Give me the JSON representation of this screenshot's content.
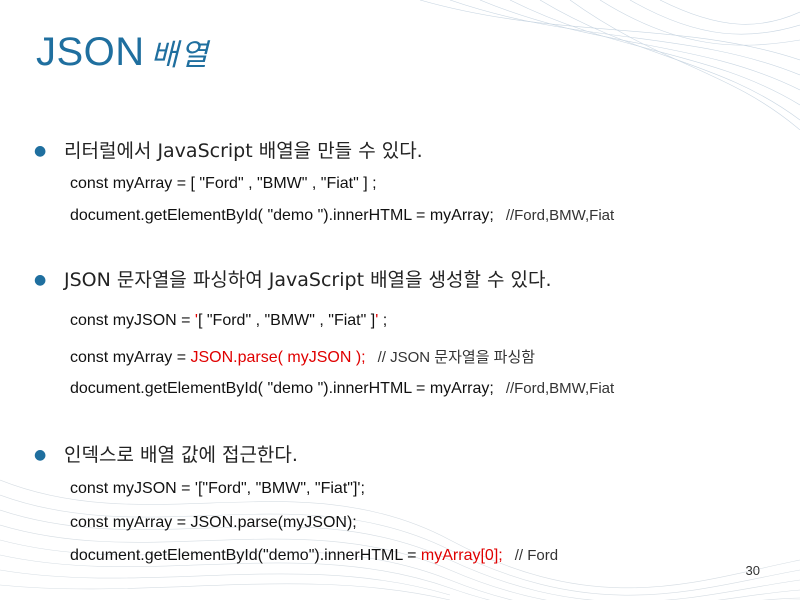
{
  "slide": {
    "title": "JSON",
    "title_ko": "배열",
    "page_number": "30"
  },
  "bullets": [
    {
      "text": "리터럴에서 JavaScript 배열을 만들 수 있다.",
      "lines": [
        {
          "code": "const myArray = [ \"Ford\" , \"BMW\" , \"Fiat\" ] ;"
        },
        {
          "code": "document.getElementById( \"demo \").innerHTML = myArray;",
          "comment": "//Ford,BMW,Fiat"
        }
      ]
    },
    {
      "text": "JSON 문자열을 파싱하여 JavaScript 배열을 생성할 수 있다.",
      "lines": [
        {
          "code_a": "const myJSON = ",
          "code_hl": "'",
          "code_b": "[ \"Ford\" , \"BMW\" , \"Fiat\" ]",
          "code_hl2": "'",
          "code_c": " ;"
        },
        {
          "code_a": "const myArray = ",
          "code_hl": "JSON.parse( myJSON );",
          "comment": "// JSON 문자열을 파싱함"
        },
        {
          "code": "document.getElementById( \"demo \").innerHTML = myArray;",
          "comment": "//Ford,BMW,Fiat"
        }
      ]
    },
    {
      "text": "인덱스로 배열 값에 접근한다.",
      "lines": [
        {
          "code": "const myJSON = '[\"Ford\", \"BMW\", \"Fiat\"]';"
        },
        {
          "code": "const myArray = JSON.parse(myJSON);"
        },
        {
          "code_a": "document.getElementById(\"demo\").innerHTML = ",
          "code_hl": "myArray[0];",
          "comment": "// Ford"
        }
      ]
    }
  ],
  "colors": {
    "title": "#1f6f9f",
    "highlight": "#e00000",
    "bullet": "#1f6f9f"
  }
}
